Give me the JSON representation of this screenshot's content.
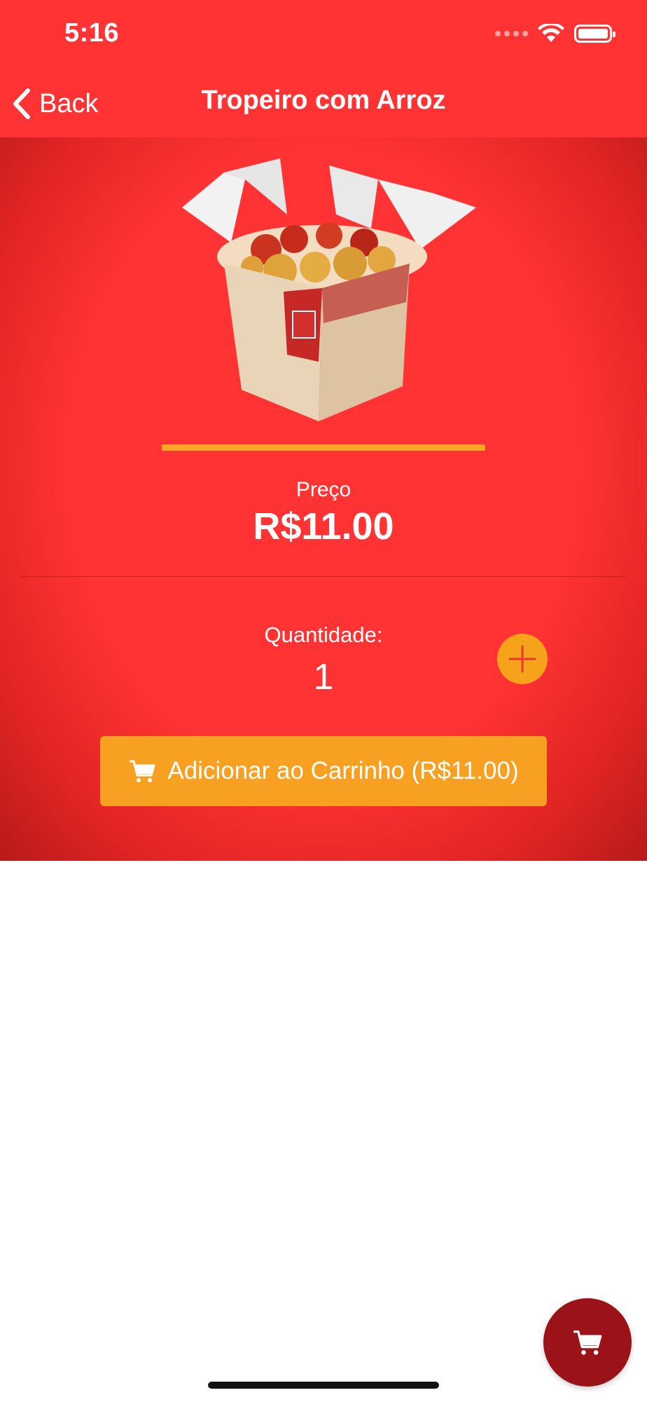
{
  "status_bar": {
    "time": "5:16"
  },
  "nav": {
    "back_label": "Back",
    "title": "Tropeiro com Arroz"
  },
  "product": {
    "image_alt": "Tropeiro com Arroz",
    "progress": 1.0,
    "price_label": "Preço",
    "price": "R$11.00",
    "quantity_label": "Quantidade:",
    "quantity": "1"
  },
  "actions": {
    "add_to_cart_label": "Adicionar ao Carrinho (R$11.00)"
  },
  "colors": {
    "primary": "#ff3333",
    "accent": "#f7a021",
    "fab": "#9b1218"
  },
  "icons": {
    "back": "chevron-left-icon",
    "plus": "plus-icon",
    "cart": "cart-icon"
  }
}
